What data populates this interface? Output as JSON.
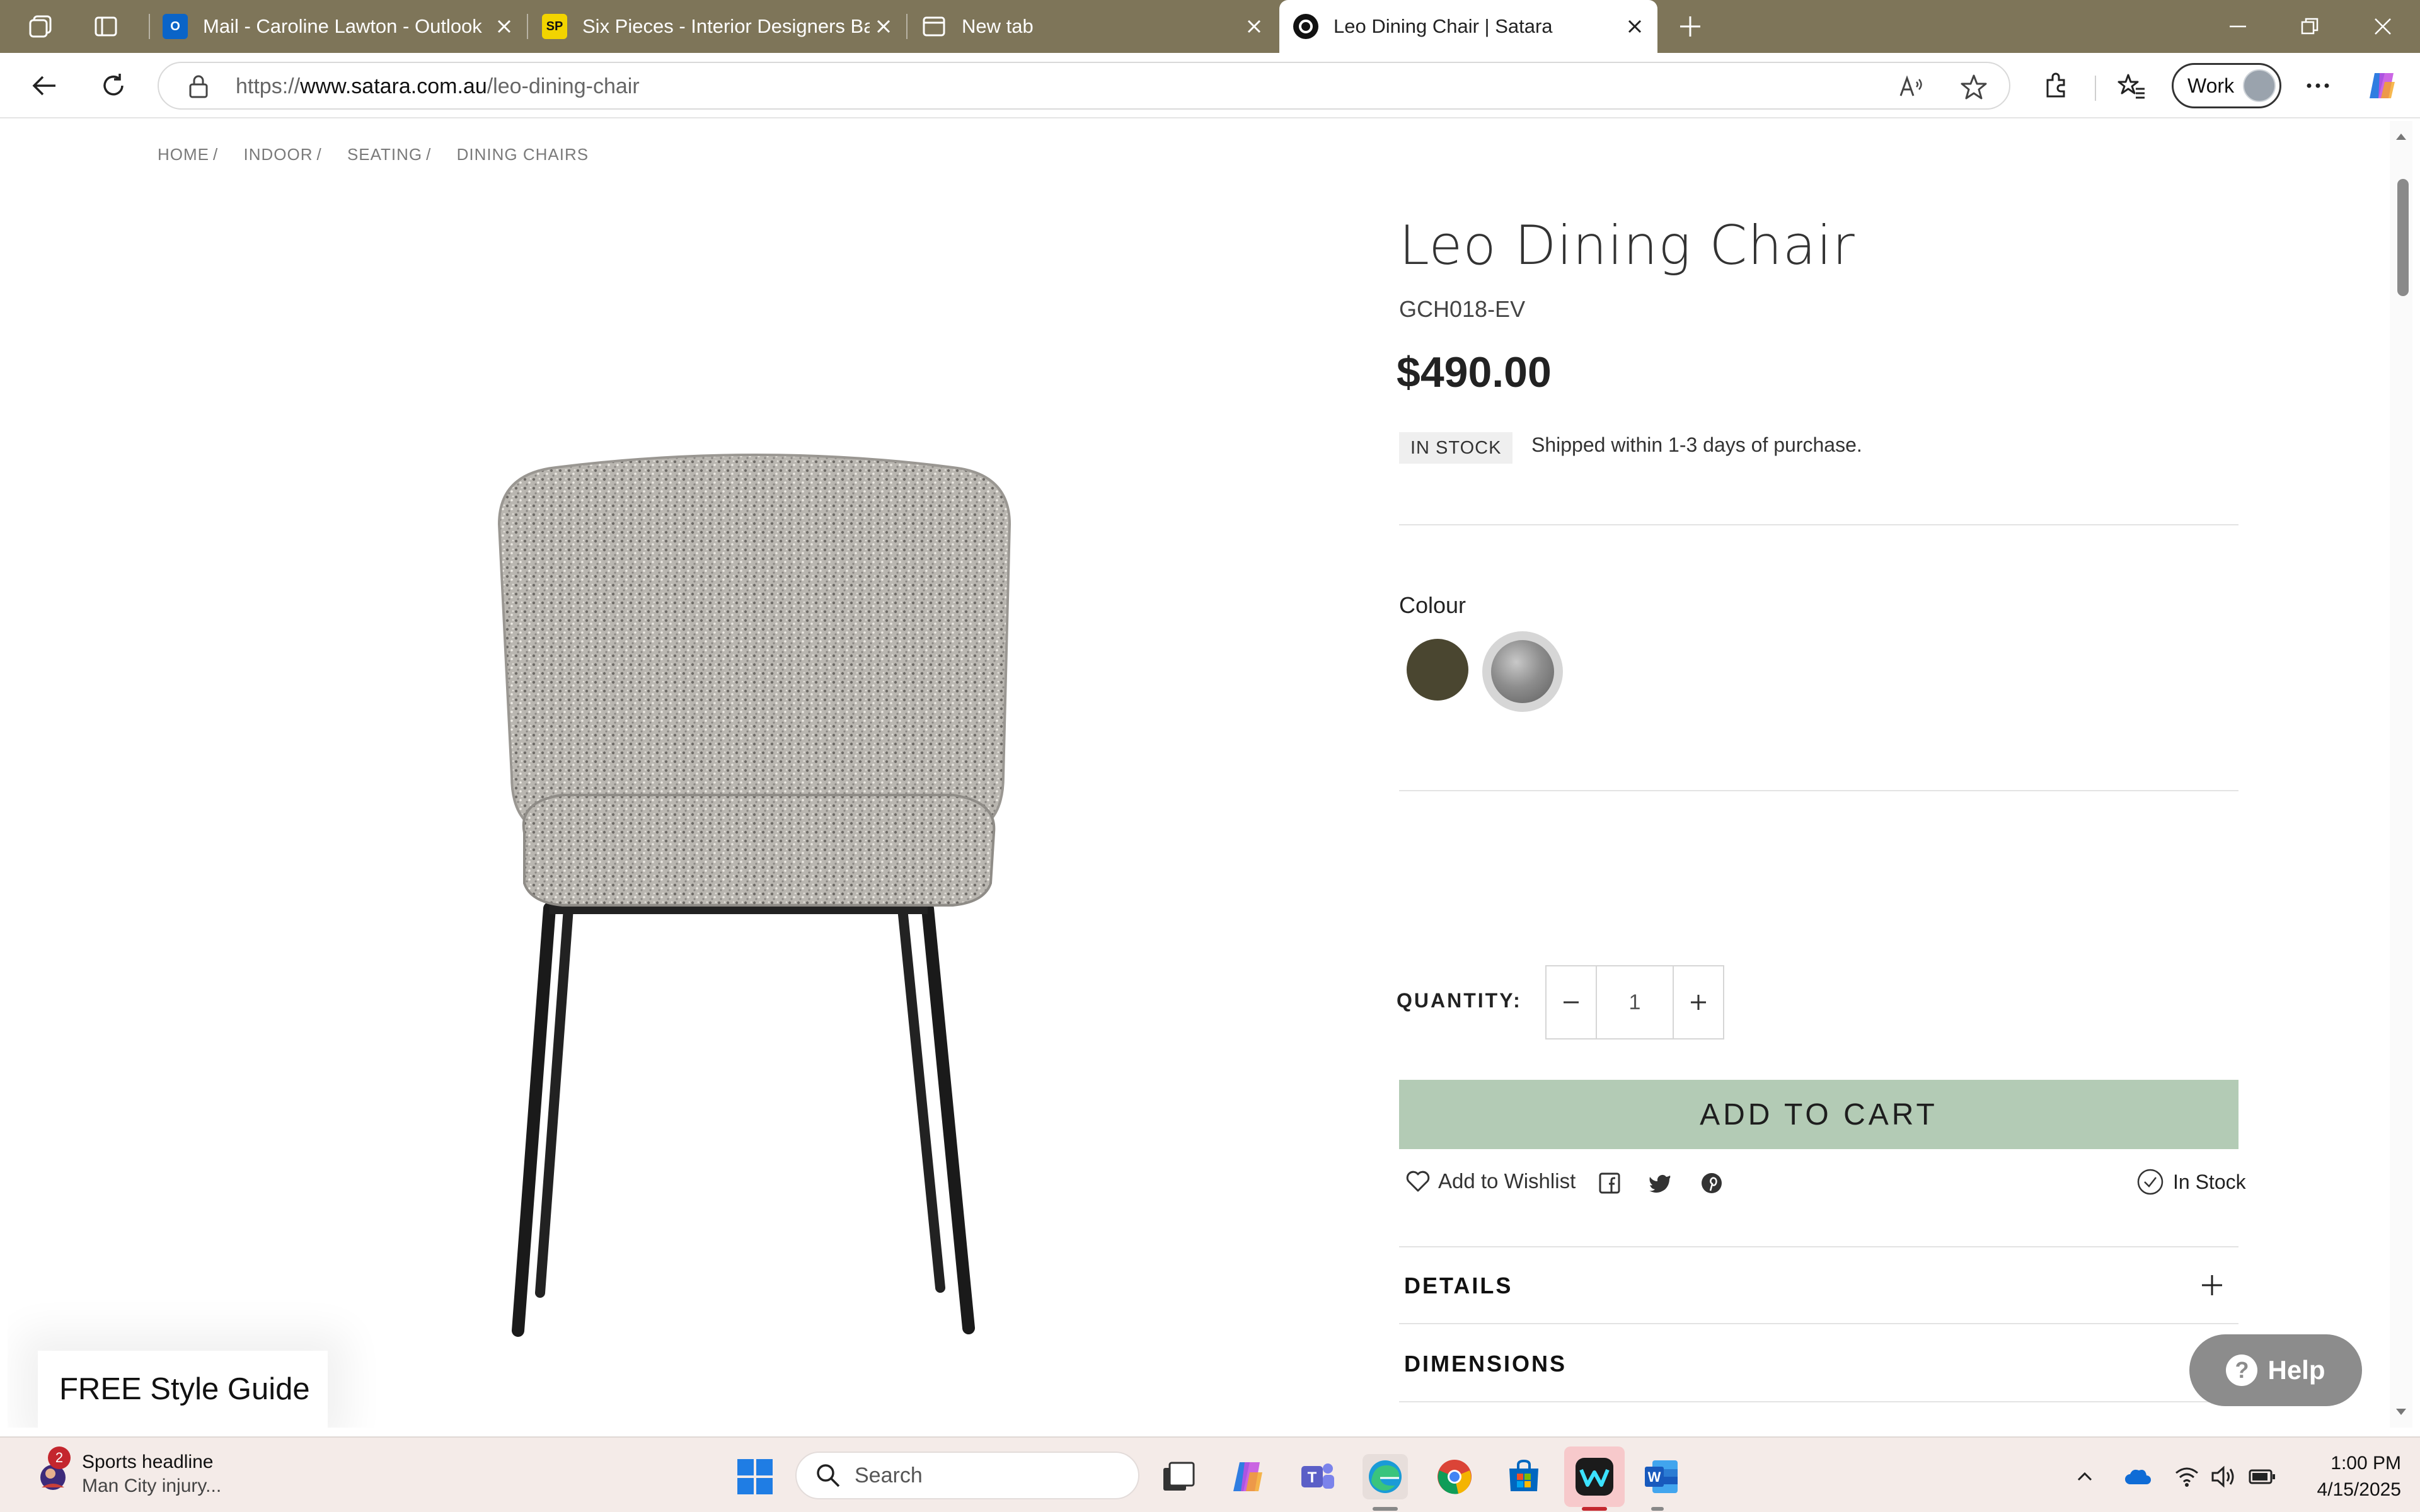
{
  "browser": {
    "tabs": [
      {
        "title": "Mail - Caroline Lawton - Outlook",
        "favicon": "outlook-icon"
      },
      {
        "title": "Six Pieces - Interior Designers Bay",
        "favicon": "sixpieces-icon"
      },
      {
        "title": "New tab",
        "favicon": "newtab-icon"
      },
      {
        "title": "Leo Dining Chair | Satara",
        "favicon": "satara-icon",
        "active": true
      }
    ],
    "url_prefix": "https://",
    "url_domain": "www.satara.com.au",
    "url_path": "/leo-dining-chair",
    "profile_label": "Work"
  },
  "breadcrumb": {
    "items": [
      "HOME",
      "INDOOR",
      "SEATING",
      "DINING CHAIRS"
    ],
    "separator": "/"
  },
  "product": {
    "title": "Leo Dining Chair",
    "sku": "GCH018-EV",
    "price": "$490.00",
    "stock_badge": "IN STOCK",
    "shipping_text": "Shipped within 1-3 days of purchase.",
    "colour_label": "Colour",
    "colours": [
      {
        "name": "olive",
        "hex": "#4a4630"
      },
      {
        "name": "grey-boucle",
        "hex": "#8e8e8e",
        "selected": true
      }
    ],
    "quantity_label": "QUANTITY:",
    "quantity_value": "1",
    "add_to_cart_label": "ADD TO CART",
    "wishlist_label": "Add to Wishlist",
    "availability_label": "In Stock",
    "accordions": [
      "DETAILS",
      "DIMENSIONS"
    ]
  },
  "widgets": {
    "style_guide_label": "FREE Style Guide",
    "help_label": "Help"
  },
  "taskbar": {
    "news_badge": "2",
    "news_title": "Sports headline",
    "news_subtitle": "Man City injury...",
    "search_placeholder": "Search",
    "time": "1:00 PM",
    "date": "4/15/2025"
  },
  "colors": {
    "tabstrip": "#7e7559",
    "add_to_cart": "#b3cbb5",
    "help_button": "#8c8c8c"
  }
}
